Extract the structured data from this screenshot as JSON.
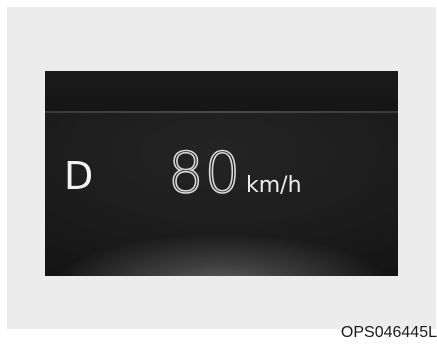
{
  "display": {
    "gear": "D",
    "speed_value": "80",
    "speed_unit": "km/h"
  },
  "caption": {
    "figure_code": "OPS046445L"
  }
}
